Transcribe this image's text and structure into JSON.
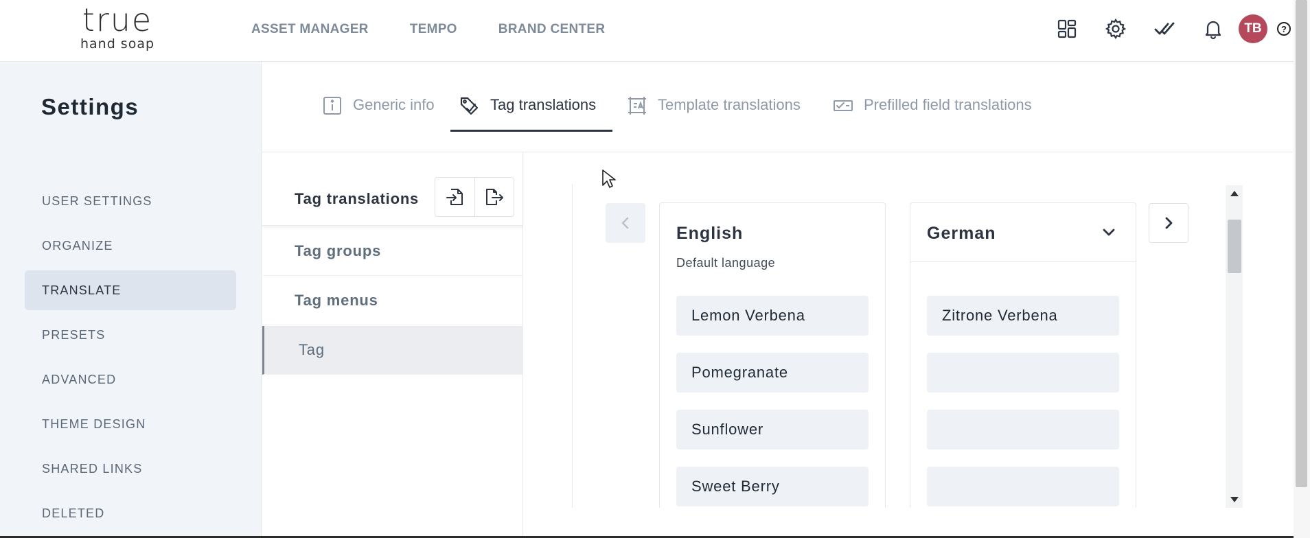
{
  "brand": {
    "logo_main": "true",
    "logo_sub": "hand soap"
  },
  "topnav": {
    "items": [
      "ASSET MANAGER",
      "TEMPO",
      "BRAND CENTER"
    ]
  },
  "header_icons": [
    "apps-grid-icon",
    "gear-icon",
    "double-check-icon",
    "bell-icon"
  ],
  "user": {
    "initials": "TB",
    "avatar_color": "#b5485a"
  },
  "help": {
    "label": "?"
  },
  "sidebar": {
    "title": "Settings",
    "items": [
      {
        "label": "USER SETTINGS",
        "active": false
      },
      {
        "label": "ORGANIZE",
        "active": false
      },
      {
        "label": "TRANSLATE",
        "active": true
      },
      {
        "label": "PRESETS",
        "active": false
      },
      {
        "label": "ADVANCED",
        "active": false
      },
      {
        "label": "THEME DESIGN",
        "active": false
      },
      {
        "label": "SHARED LINKS",
        "active": false
      },
      {
        "label": "DELETED",
        "active": false
      }
    ]
  },
  "tabs": [
    {
      "label": "Generic info",
      "icon": "info-icon",
      "active": false
    },
    {
      "label": "Tag translations",
      "icon": "tag-icon",
      "active": true
    },
    {
      "label": "Template translations",
      "icon": "template-icon",
      "active": false
    },
    {
      "label": "Prefilled field translations",
      "icon": "prefilled-field-icon",
      "active": false
    }
  ],
  "tag_panel": {
    "title": "Tag translations",
    "import_icon": "import-file-icon",
    "export_icon": "export-file-icon",
    "items": [
      {
        "label": "Tag groups",
        "active": false
      },
      {
        "label": "Tag menus",
        "active": false
      },
      {
        "label": "Tag",
        "active": true
      }
    ]
  },
  "languages": {
    "source": {
      "name": "English",
      "subtitle": "Default language",
      "values": [
        "Lemon Verbena",
        "Pomegranate",
        "Sunflower",
        "Sweet Berry"
      ]
    },
    "target": {
      "name": "German",
      "values": [
        "Zitrone Verbena",
        "",
        "",
        ""
      ]
    }
  },
  "colors": {
    "sidebar_bg": "#f1f4f8",
    "active_item_bg": "#dde4ee",
    "field_bg": "#eef2f7",
    "text_dark": "#2b3440",
    "text_muted": "#8e9aa8"
  }
}
